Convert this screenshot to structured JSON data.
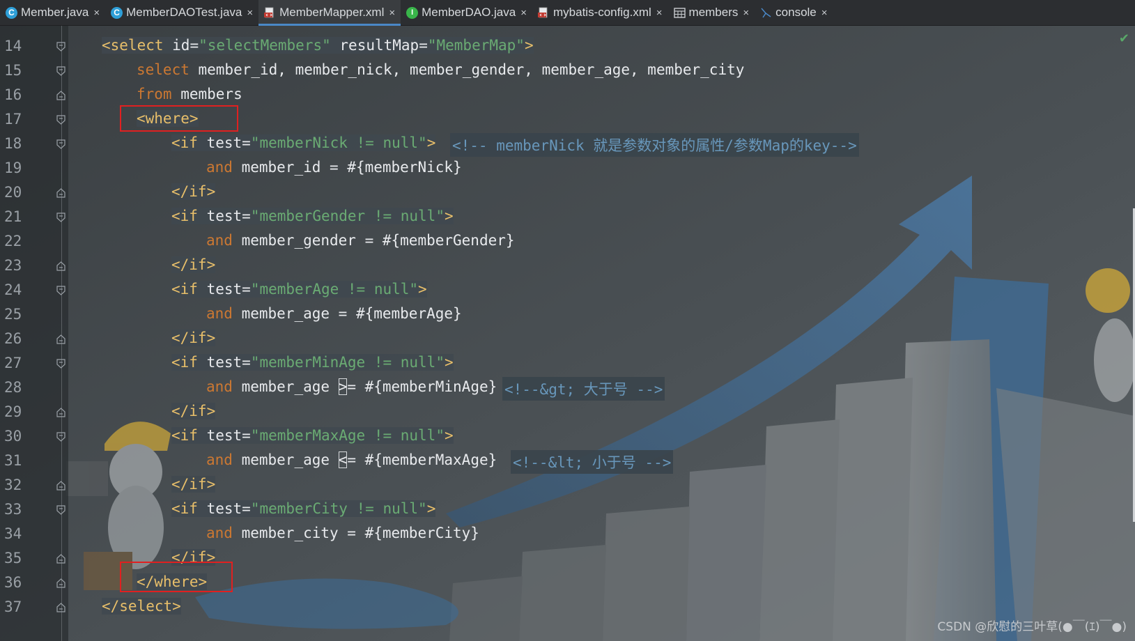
{
  "tabs": [
    {
      "label": "Member.java",
      "icon": "java-class-icon",
      "active": false
    },
    {
      "label": "MemberDAOTest.java",
      "icon": "java-class-icon",
      "active": false
    },
    {
      "label": "MemberMapper.xml",
      "icon": "xml-file-icon",
      "active": true
    },
    {
      "label": "MemberDAO.java",
      "icon": "java-interface-icon",
      "active": false
    },
    {
      "label": "mybatis-config.xml",
      "icon": "xml-file-icon",
      "active": false
    },
    {
      "label": "members",
      "icon": "table-icon",
      "active": false
    },
    {
      "label": "console",
      "icon": "console-icon",
      "active": false
    }
  ],
  "close_glyph": "×",
  "icon_letters": {
    "class": "C",
    "interface": "I"
  },
  "code": {
    "line_numbers": [
      "14",
      "15",
      "16",
      "17",
      "18",
      "19",
      "20",
      "21",
      "22",
      "23",
      "24",
      "25",
      "26",
      "27",
      "28",
      "29",
      "30",
      "31",
      "32",
      "33",
      "34",
      "35",
      "36",
      "37"
    ],
    "l14": {
      "open": "<select",
      "id_attr": " id",
      "eq": "=",
      "id_val": "\"selectMembers\"",
      "rm_attr": " resultMap",
      "rm_val": "\"MemberMap\"",
      "close": ">"
    },
    "l15": {
      "kw": "select",
      "cols": " member_id, member_nick, member_gender, member_age, member_city"
    },
    "l16": {
      "kw": "from",
      "rest": " members"
    },
    "l17": {
      "tag": "<where>"
    },
    "if_open": "<if",
    "if_close": "</if>",
    "test_attr": " test",
    "eq": "=",
    "gt": ">",
    "and_kw": "and",
    "l18": {
      "val": "\"memberNick != null\"",
      "comment": "<!-- memberNick 就是参数对象的属性/参数Map的key-->"
    },
    "l19": {
      "rest": " member_id = #{memberNick}"
    },
    "l21": {
      "val": "\"memberGender != null\""
    },
    "l22": {
      "rest": " member_gender = #{memberGender}"
    },
    "l24": {
      "val": "\"memberAge != null\""
    },
    "l25": {
      "rest": " member_age = #{memberAge}"
    },
    "l27": {
      "val": "\"memberMinAge != null\""
    },
    "l28": {
      "pre": " member_age ",
      "op": ">",
      "post": "= #{memberMinAge}",
      "comment": "<!--&gt; 大于号 -->"
    },
    "l30": {
      "val": "\"memberMaxAge != null\""
    },
    "l31": {
      "pre": " member_age ",
      "op": "<",
      "post": "= #{memberMaxAge}",
      "comment": "<!--&lt; 小于号 -->"
    },
    "l33": {
      "val": "\"memberCity != null\""
    },
    "l34": {
      "rest": " member_city = #{memberCity}"
    },
    "l36": {
      "tag": "</where>"
    },
    "l37": {
      "tag": "</select>"
    }
  },
  "status": {
    "check": "✔"
  },
  "watermark": "CSDN @欣慰的三叶草(●￣(ｴ)￣●)",
  "colors": {
    "tag": "#e8bf6a",
    "string": "#6aab73",
    "keyword": "#cc7832",
    "comment": "#6897bb",
    "highlight_box": "#e02020",
    "active_tab_underline": "#4a88c7"
  }
}
